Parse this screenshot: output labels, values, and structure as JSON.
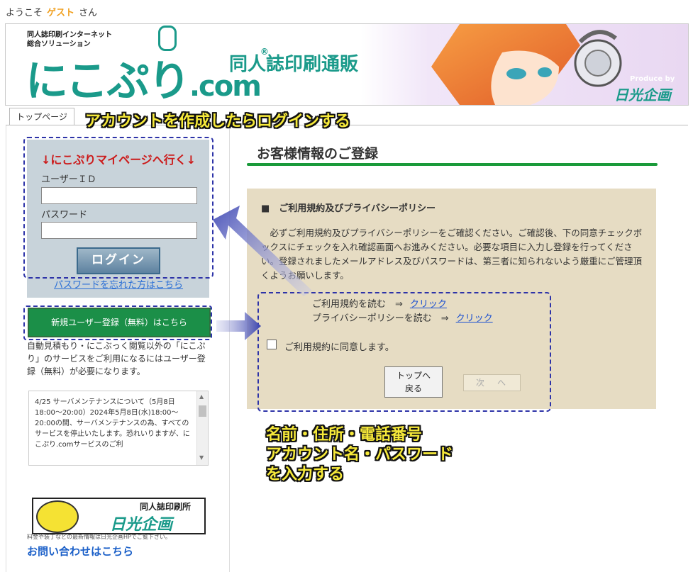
{
  "header": {
    "greeting_prefix": "ようこそ",
    "guest_name": "ゲスト",
    "greeting_suffix": "さん"
  },
  "banner": {
    "tagline_1": "同人誌印刷インターネット",
    "tagline_2": "総合ソリューション",
    "logo_text": "にこぷり",
    "logo_domain": ".com",
    "logo_reg": "®",
    "service_title": "同人誌印刷通販",
    "produce_by": "Produce by",
    "company": "日光企画"
  },
  "tabs": {
    "top_page": "トップページ"
  },
  "login": {
    "title": "↓にこぷりマイページへ行く↓",
    "user_id_label": "ユーザーＩＤ",
    "password_label": "パスワード",
    "user_id_value": "",
    "password_value": "",
    "login_button": "ログイン",
    "forgot_link": "パスワードを忘れた方はこちら"
  },
  "register": {
    "button": "新規ユーザー登録（無料）はこちら",
    "note": "自動見積もり・にこぶっく閲覧以外の「にこぷり」のサービスをご利用になるにはユーザー登録（無料）が必要になります。"
  },
  "news": {
    "date": "4/25",
    "text": "サーバメンテナンスについて（5月8日18:00～20:00）2024年5月8日(水)18:00～20:00の間、サーバメンテナンスの為、すべてのサービスを停止いたします。恐れいりますが、にこぷり.comサービスのご利"
  },
  "footer": {
    "logo_sub": "同人誌印刷所",
    "logo_brand": "日光企画",
    "small_note": "料金や装丁などの最新情報は日光企画HPでご覧下さい。",
    "contact_link": "お問い合わせはこちら"
  },
  "main": {
    "page_title": "お客様情報のご登録",
    "terms_heading": "■　ご利用規約及びプライバシーポリシー",
    "terms_body": "　必ずご利用規約及びプライバシーポリシーをご確認ください。ご確認後、下の同意チェックボックスにチェックを入れ確認画面へお進みください。必要な項目に入力し登録を行ってください。登録されましたメールアドレス及びパスワードは、第三者に知られないよう厳重にご管理頂くようお願いします。",
    "read_terms": "ご利用規約を読む　⇒",
    "read_privacy": "プライバシーポリシーを読む　⇒",
    "click_link": "クリック",
    "agree_label": "ご利用規約に同意します。",
    "agree_checked": false,
    "back_button": "トップへ戻る",
    "next_button": "次　へ"
  },
  "annotations": {
    "top_callout": "アカウントを作成したらログインする",
    "bottom_callout_1": "名前・住所・電話番号",
    "bottom_callout_2": "アカウント名・パスワード",
    "bottom_callout_3": "を入力する"
  },
  "colors": {
    "brand_teal": "#1a9a8a",
    "login_panel": "#c8d3da",
    "register_green": "#1b8f48",
    "terms_panel": "#e6dcc3",
    "annotation_dash": "#2d33a8",
    "callout_yellow": "#f6e93a"
  }
}
